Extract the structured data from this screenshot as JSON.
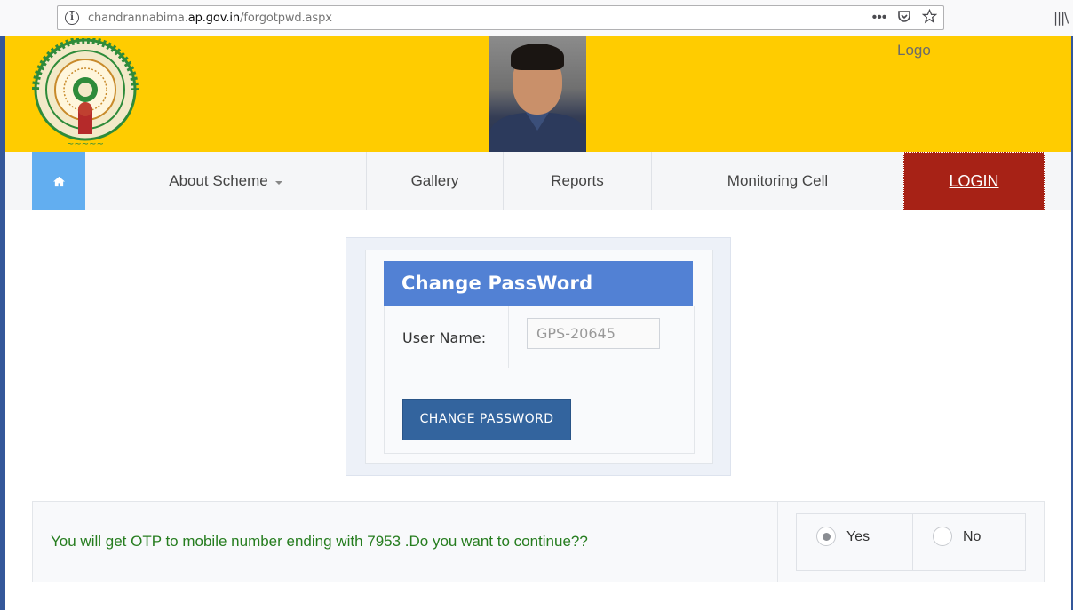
{
  "browser": {
    "url_prefix": "chandrannabima.",
    "url_domain": "ap.gov.in",
    "url_path": "/forgotpwd.aspx"
  },
  "header": {
    "logo_text": "Logo"
  },
  "nav": {
    "home_icon": "home-icon",
    "about": "About Scheme",
    "gallery": "Gallery",
    "reports": "Reports",
    "monitoring": "Monitoring Cell",
    "login": "LOGIN"
  },
  "form": {
    "title": "Change PassWord",
    "user_label": "User Name:",
    "user_value": "GPS-20645",
    "button": "CHANGE PASSWORD"
  },
  "otp": {
    "message": "You will get OTP to mobile number ending with 7953 .Do you want to continue??",
    "yes": "Yes",
    "no": "No",
    "selected": "Yes"
  },
  "colors": {
    "header_bg": "#ffcc00",
    "home_bg": "#62aef0",
    "login_bg": "#a72216",
    "title_bg": "#5281d4",
    "button_bg": "#33649e",
    "otp_text": "#267d1f"
  }
}
